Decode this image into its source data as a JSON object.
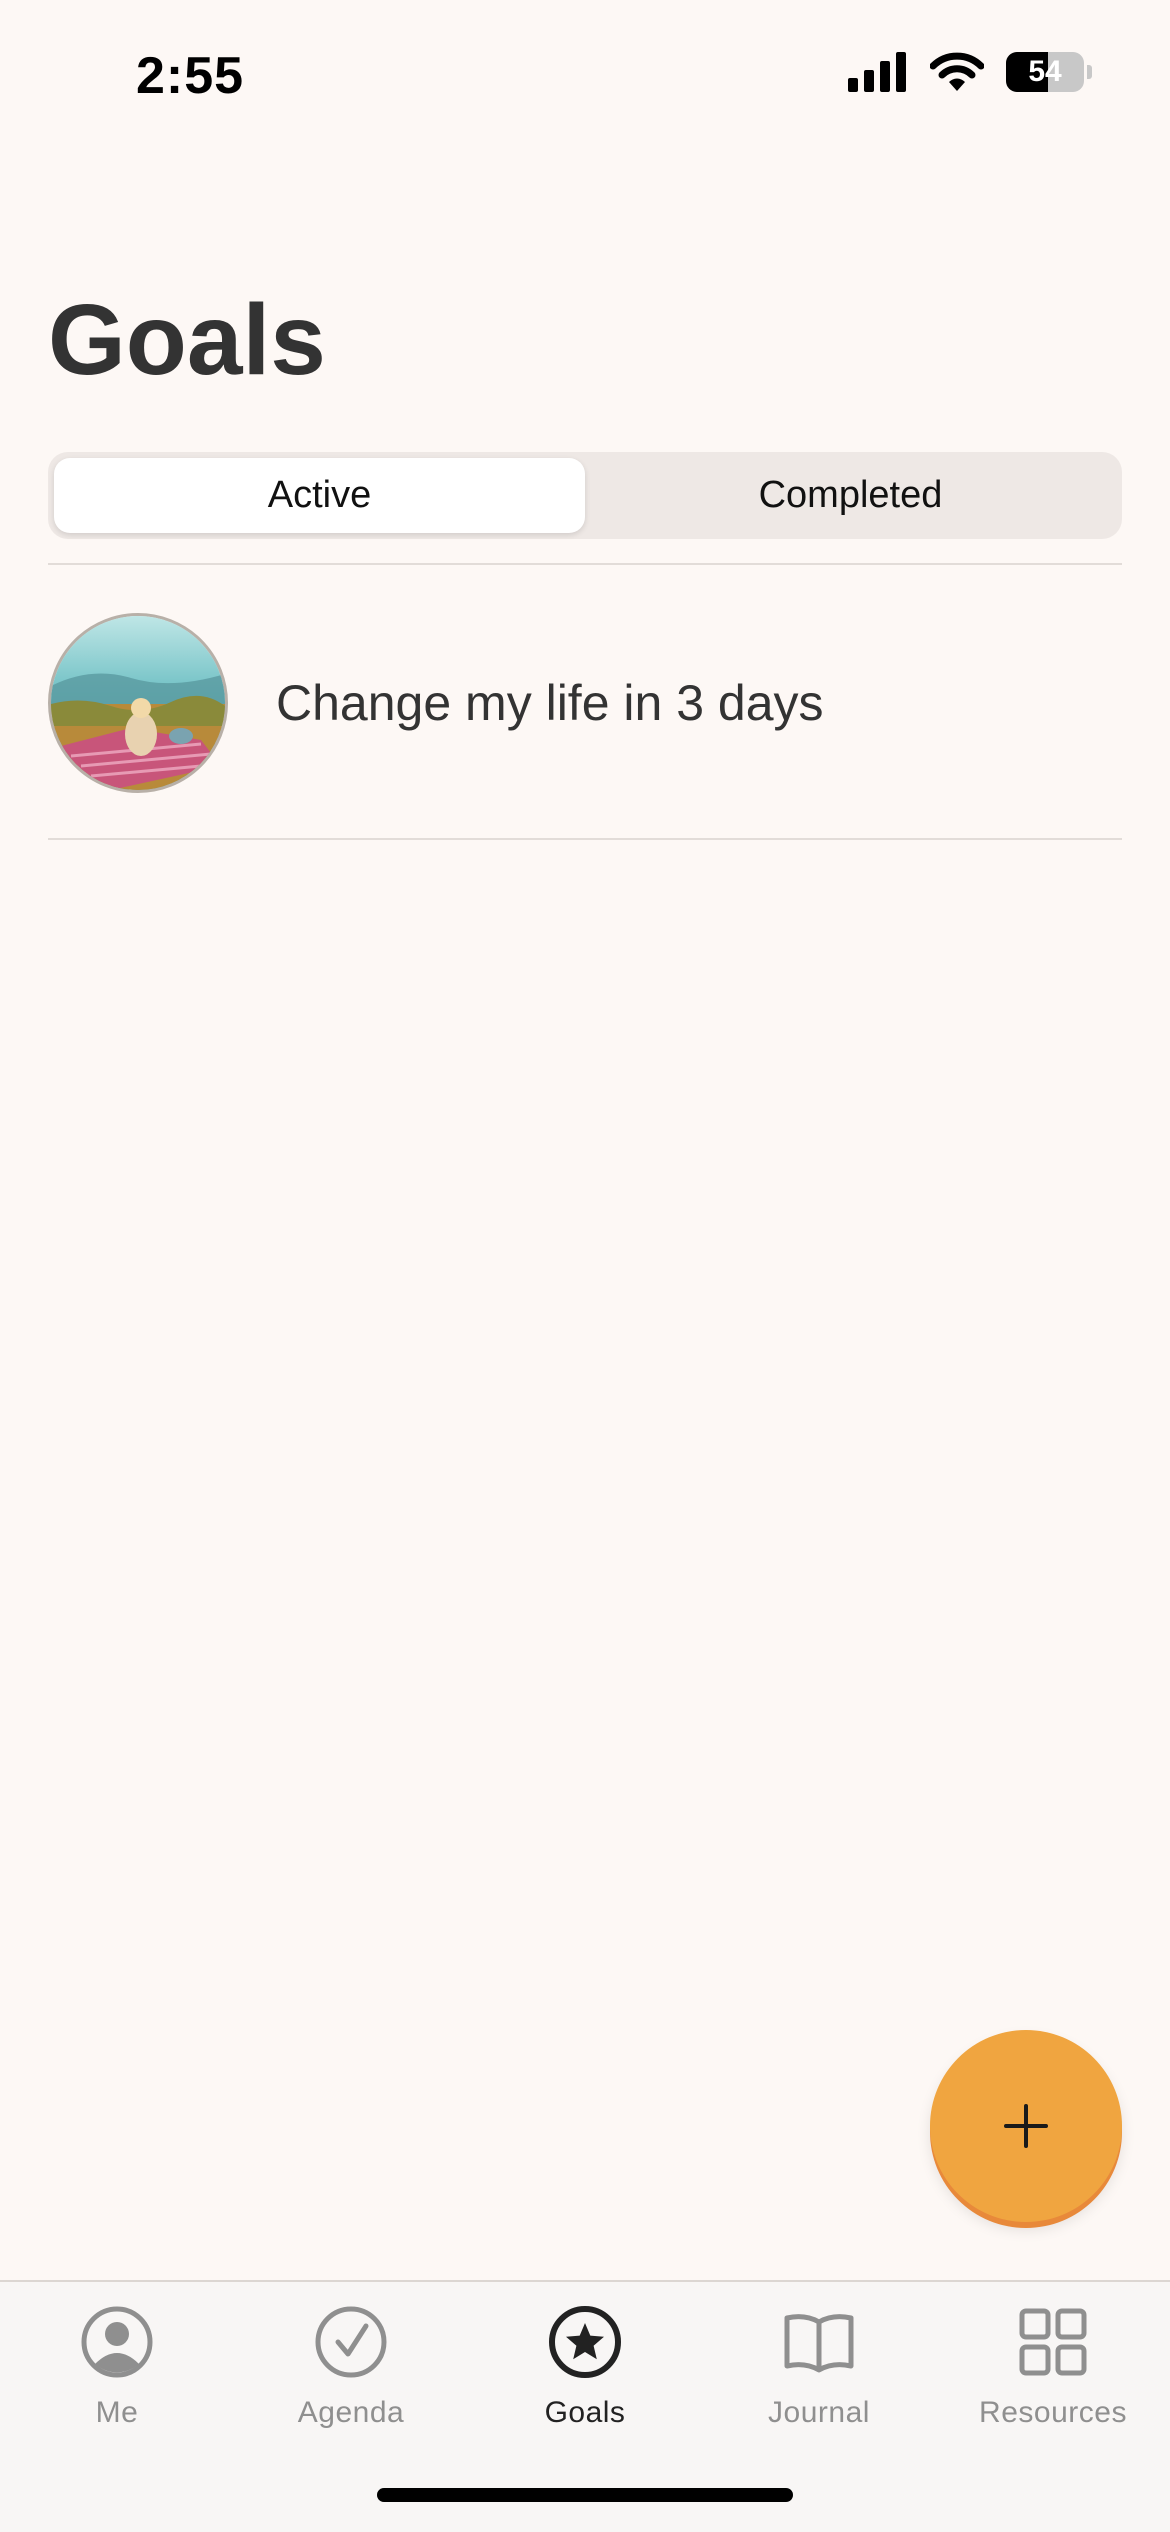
{
  "status_bar": {
    "time": "2:55",
    "battery_level": "54",
    "battery_fraction": 0.54
  },
  "header": {
    "title": "Goals"
  },
  "segmented_control": {
    "segments": [
      {
        "label": "Active",
        "selected": true
      },
      {
        "label": "Completed",
        "selected": false
      }
    ]
  },
  "goals": [
    {
      "title": "Change my life in 3 days"
    }
  ],
  "fab": {
    "icon": "plus-icon",
    "color": "#f0a540"
  },
  "tab_bar": {
    "items": [
      {
        "label": "Me",
        "icon": "person-icon",
        "active": false
      },
      {
        "label": "Agenda",
        "icon": "check-circle-icon",
        "active": false
      },
      {
        "label": "Goals",
        "icon": "star-circle-icon",
        "active": true
      },
      {
        "label": "Journal",
        "icon": "book-icon",
        "active": false
      },
      {
        "label": "Resources",
        "icon": "grid-icon",
        "active": false
      }
    ]
  },
  "colors": {
    "background": "#fdf8f5",
    "accent": "#f0a540",
    "inactive_tab": "#8f8f8f"
  }
}
